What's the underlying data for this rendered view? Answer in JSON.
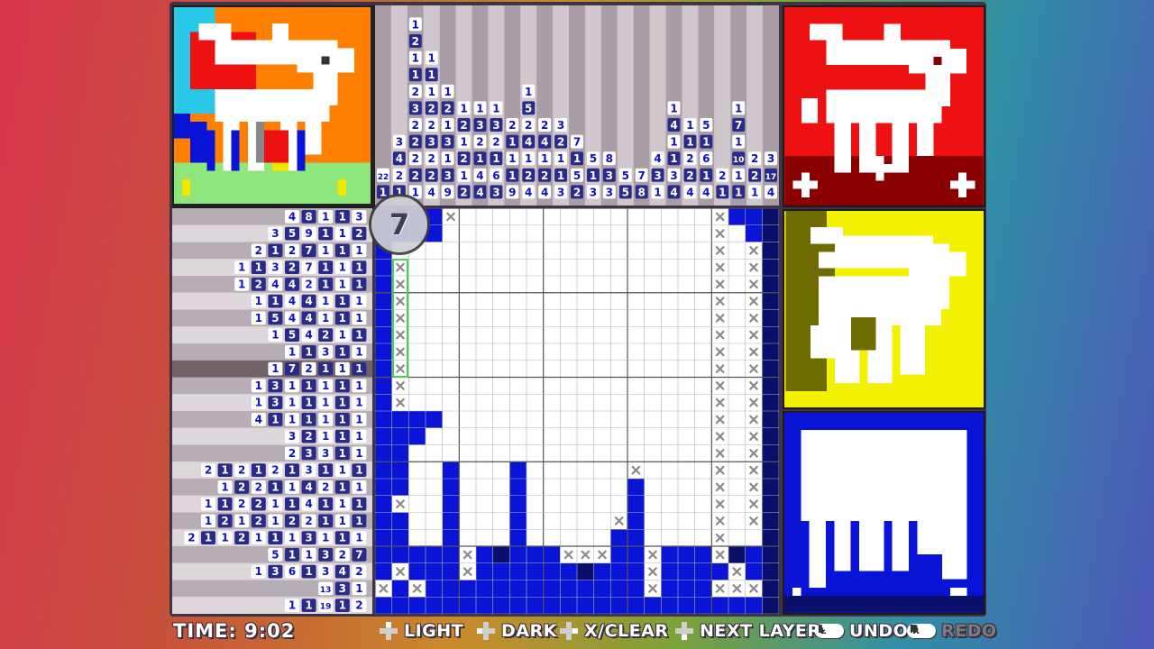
{
  "timer": {
    "label": "TIME: 9:02"
  },
  "layer_badge": "7",
  "controls": {
    "light": "LIGHT",
    "dark": "DARK",
    "clear": "X/CLEAR",
    "next_layer": "NEXT LAYER",
    "undo": "UNDO",
    "redo": "REDO",
    "undo_key": "L",
    "redo_key": "R"
  },
  "colors": {
    "blue": "#0a14d6",
    "navy": "#0a0f6b",
    "grid_line": "#9a9a9a",
    "red": "#ee1111",
    "yellow": "#f2f200",
    "olive": "#6e6b00"
  },
  "row_clues": [
    [
      "4",
      "8",
      "1",
      "1",
      "3"
    ],
    [
      "3",
      "5",
      "9",
      "1",
      "1",
      "2"
    ],
    [
      "2",
      "1",
      "2",
      "7",
      "1",
      "1",
      "1"
    ],
    [
      "1",
      "1",
      "3",
      "2",
      "7",
      "1",
      "1",
      "1"
    ],
    [
      "1",
      "2",
      "4",
      "4",
      "2",
      "1",
      "1",
      "1"
    ],
    [
      "1",
      "1",
      "4",
      "4",
      "1",
      "1",
      "1"
    ],
    [
      "1",
      "5",
      "4",
      "4",
      "1",
      "1",
      "1"
    ],
    [
      "1",
      "5",
      "4",
      "2",
      "1",
      "1"
    ],
    [
      "1",
      "1",
      "3",
      "1",
      "1"
    ],
    [
      "1",
      "7",
      "2",
      "1",
      "1",
      "1"
    ],
    [
      "1",
      "3",
      "1",
      "1",
      "1",
      "1",
      "1"
    ],
    [
      "1",
      "3",
      "1",
      "1",
      "1",
      "1",
      "1"
    ],
    [
      "4",
      "1",
      "1",
      "1",
      "1",
      "1",
      "1"
    ],
    [
      "3",
      "2",
      "1",
      "1",
      "1"
    ],
    [
      "2",
      "3",
      "3",
      "1",
      "1"
    ],
    [
      "2",
      "1",
      "2",
      "1",
      "2",
      "1",
      "3",
      "1",
      "1",
      "1"
    ],
    [
      "1",
      "2",
      "2",
      "1",
      "1",
      "4",
      "2",
      "1",
      "1"
    ],
    [
      "1",
      "1",
      "2",
      "2",
      "1",
      "1",
      "4",
      "1",
      "1",
      "1"
    ],
    [
      "1",
      "2",
      "1",
      "2",
      "1",
      "2",
      "2",
      "1",
      "1",
      "1"
    ],
    [
      "2",
      "1",
      "1",
      "2",
      "1",
      "1",
      "1",
      "3",
      "1",
      "1",
      "1"
    ],
    [
      "5",
      "1",
      "1",
      "3",
      "2",
      "7"
    ],
    [
      "1",
      "3",
      "6",
      "1",
      "3",
      "4",
      "2"
    ],
    [
      "13",
      "3",
      "1"
    ],
    [
      "1",
      "1",
      "19",
      "1",
      "2"
    ]
  ],
  "col_clues": [
    [
      "22",
      "1"
    ],
    [
      "3",
      "4",
      "2",
      "1"
    ],
    [
      "1",
      "2",
      "1",
      "1",
      "2",
      "3",
      "2",
      "2",
      "2",
      "2",
      "1"
    ],
    [
      "1",
      "1",
      "1",
      "2",
      "2",
      "3",
      "2",
      "2",
      "4"
    ],
    [
      "1",
      "2",
      "1",
      "3",
      "1",
      "3",
      "9"
    ],
    [
      "1",
      "2",
      "1",
      "2",
      "1",
      "2"
    ],
    [
      "1",
      "3",
      "2",
      "1",
      "4",
      "4"
    ],
    [
      "1",
      "3",
      "2",
      "1",
      "6",
      "3"
    ],
    [
      "2",
      "1",
      "1",
      "1",
      "9"
    ],
    [
      "1",
      "5",
      "2",
      "4",
      "1",
      "2",
      "4"
    ],
    [
      "2",
      "4",
      "1",
      "2",
      "4"
    ],
    [
      "3",
      "2",
      "1",
      "1",
      "3"
    ],
    [
      "7",
      "1",
      "5",
      "2"
    ],
    [
      "5",
      "1",
      "3"
    ],
    [
      "8",
      "3",
      "3"
    ],
    [
      "5",
      "5"
    ],
    [
      "7",
      "8"
    ],
    [
      "4",
      "3",
      "1"
    ],
    [
      "1",
      "4",
      "1",
      "1",
      "3",
      "4"
    ],
    [
      "1",
      "1",
      "2",
      "2",
      "4"
    ],
    [
      "5",
      "1",
      "6",
      "1",
      "4"
    ],
    [
      "2",
      "1"
    ],
    [
      "1",
      "7",
      "1",
      "10",
      "1",
      "1"
    ],
    [
      "2",
      "2",
      "1"
    ],
    [
      "3",
      "17",
      "4"
    ]
  ]
}
